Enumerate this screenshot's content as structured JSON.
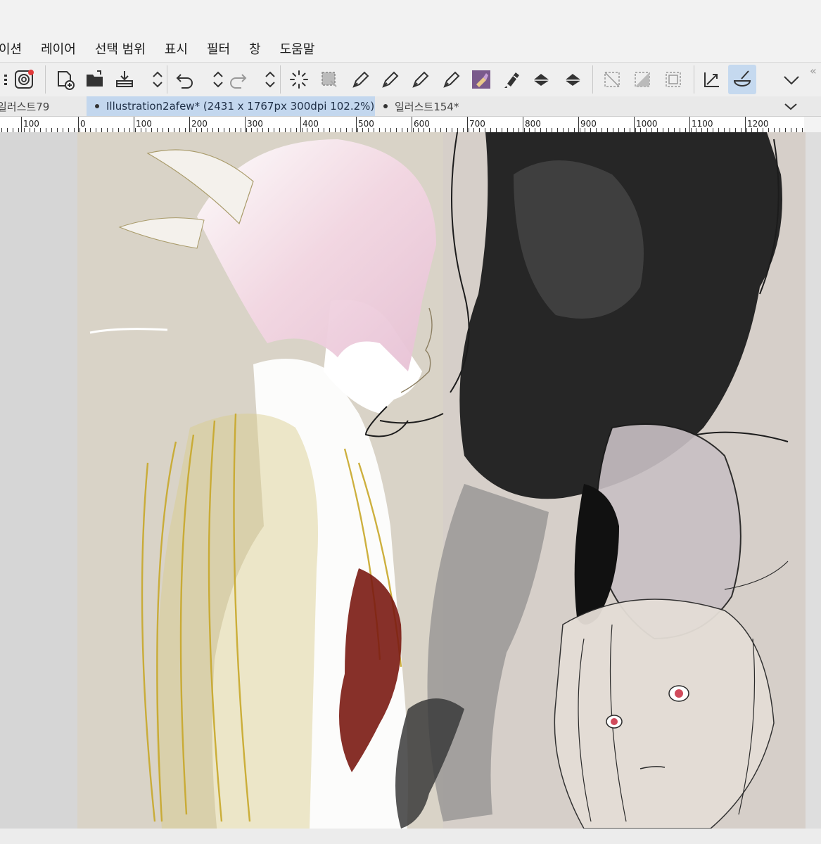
{
  "menu": [
    "이션",
    "레이어",
    "선택 범위",
    "표시",
    "필터",
    "창",
    "도움말"
  ],
  "toolbar": {
    "icons": [
      "menu-icon",
      "app-logo-icon",
      "new-canvas-icon",
      "open-folder-icon",
      "export-icon",
      "stepper-icon",
      "undo-icon",
      "stepper-icon",
      "redo-icon",
      "stepper-icon",
      "loading-spinner-icon",
      "selection-icon",
      "pen-tool-1-icon",
      "pen-tool-2-icon",
      "pen-tool-3-icon",
      "pen-tool-4-icon",
      "brush-icon",
      "marker-icon",
      "fill-icon",
      "fill-icon",
      "deselect-icon",
      "invert-selection-icon",
      "selection-border-icon",
      "transform-icon",
      "brush-active-icon",
      "chevron-down-icon"
    ],
    "active_tool": "brush-active-icon",
    "accent": "#c5d9ef"
  },
  "tabs": [
    {
      "label": "일러스트79",
      "active": false
    },
    {
      "label": "Illustration2afew* (2431 x 1767px 300dpi 102.2%)",
      "active": true
    },
    {
      "label": "일러스트154*",
      "active": false
    }
  ],
  "ruler": {
    "labels": [
      "100",
      "0",
      "100",
      "200",
      "300",
      "400",
      "500",
      "600",
      "700",
      "800",
      "900",
      "1000",
      "1100",
      "1200"
    ]
  },
  "colors": {
    "canvas_bg": "#d9d3c7",
    "active_tab": "#c3d7ee"
  }
}
